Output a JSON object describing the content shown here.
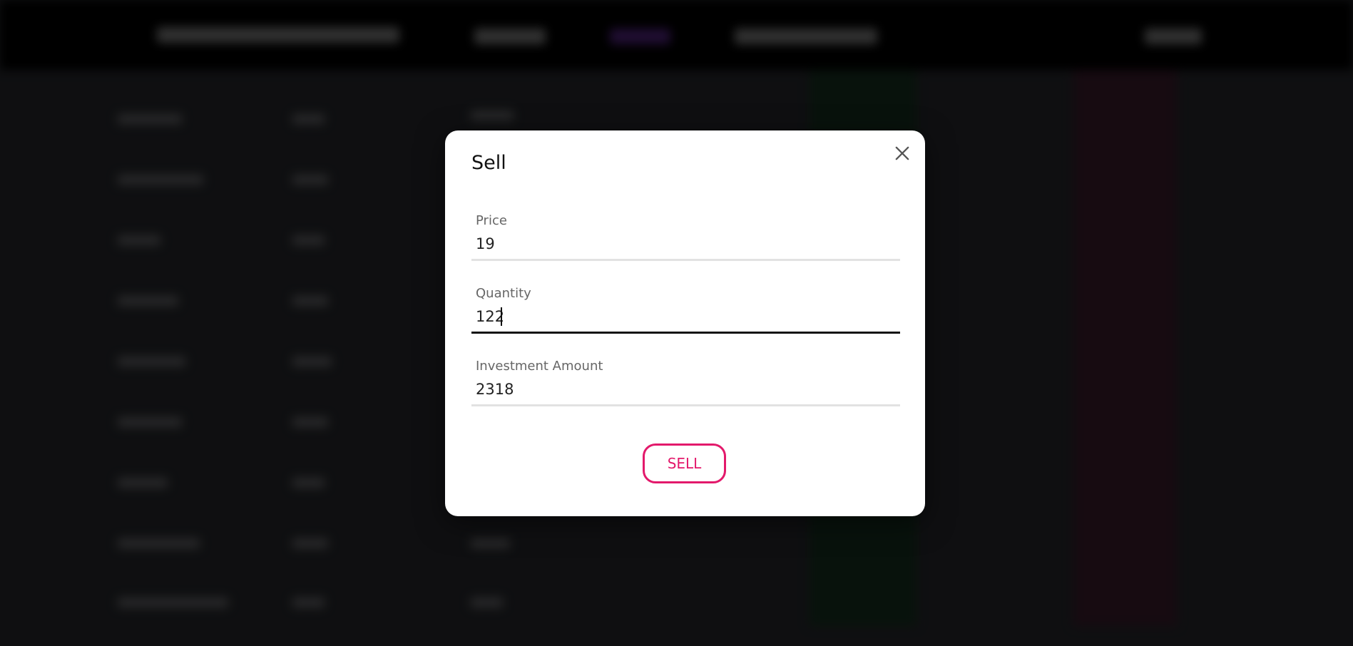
{
  "modal": {
    "title": "Sell",
    "close_icon": "close-icon",
    "fields": [
      {
        "label": "Price",
        "value": "19"
      },
      {
        "label": "Quantity",
        "value": "122"
      },
      {
        "label": "Investment Amount",
        "value": "2318"
      }
    ],
    "submit_label": "SELL"
  },
  "colors": {
    "accent": "#e3196b",
    "overlay": "#000000",
    "modal_bg": "#ffffff"
  }
}
